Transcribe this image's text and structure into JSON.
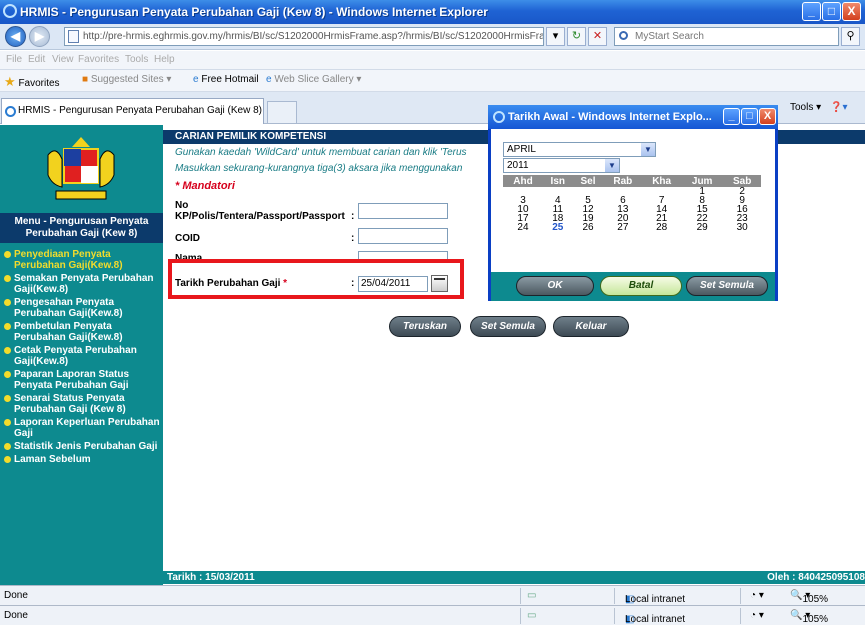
{
  "window": {
    "title": "HRMIS - Pengurusan Penyata Perubahan Gaji (Kew 8) - Windows Internet Explorer",
    "min": "_",
    "max": "□",
    "close": "X"
  },
  "address": {
    "url": "http://pre-hrmis.eghrmis.gov.my/hrmis/BI/sc/S1202000HrmisFrame.asp?/hrmis/BI/sc/S1202000HrmisFrame.as",
    "refresh": "↻",
    "stop": "✕",
    "search_placeholder": "MyStart Search"
  },
  "menubar": [
    "File",
    "Edit",
    "View",
    "Favorites",
    "Tools",
    "Help"
  ],
  "favorites": {
    "label": "Favorites",
    "items": [
      "Suggested Sites ▾",
      "Free Hotmail",
      "Web Slice Gallery ▾"
    ]
  },
  "tab": {
    "label": "HRMIS - Pengurusan Penyata Perubahan Gaji (Kew 8)",
    "tools": "Tools ▾"
  },
  "sidebar": {
    "menu_title_1": "Menu - Pengurusan Penyata",
    "menu_title_2": "Perubahan Gaji (Kew 8)",
    "items": [
      "Penyediaan Penyata Perubahan Gaji(Kew.8)",
      "Semakan Penyata Perubahan Gaji(Kew.8)",
      "Pengesahan Penyata Perubahan Gaji(Kew.8)",
      "Pembetulan Penyata Perubahan Gaji(Kew.8)",
      "Cetak Penyata Perubahan Gaji(Kew.8)",
      "Paparan Laporan Status Penyata Perubahan Gaji",
      "Senarai Status Penyata Perubahan Gaji (Kew 8)",
      "Laporan Keperluan Perubahan Gaji",
      "Statistik Jenis Perubahan Gaji",
      "Laman Sebelum"
    ]
  },
  "main": {
    "header": "CARIAN PEMILIK KOMPETENSI",
    "hint1": "Gunakan kaedah 'WildCard' untuk membuat carian dan klik 'Terus",
    "hint2": "Masukkan sekurang-kurangnya tiga(3) aksara jika menggunakan",
    "mandatory": "* Mandatori",
    "label_no1": "No",
    "label_no2": "KP/Polis/Tentera/Passport/Passport",
    "label_coid": "COID",
    "label_nama": "Nama",
    "label_tarikh": "Tarikh Perubahan Gaji",
    "tarikh_star": " *",
    "colon": ":",
    "tarikh_value": "25/04/2011",
    "buttons": [
      "Teruskan",
      "Set Semula",
      "Keluar"
    ],
    "footer_left": "Tarikh : 15/03/2011",
    "footer_right": "Oleh : 840425095108"
  },
  "popup": {
    "title": "Tarikh Awal - Windows Internet Explo...",
    "month": "APRIL",
    "year": "2011",
    "weekdays": [
      "Ahd",
      "Isn",
      "Sel",
      "Rab",
      "Kha",
      "Jum",
      "Sab"
    ],
    "weeks": [
      [
        "",
        "",
        "",
        "",
        "",
        "1",
        "2"
      ],
      [
        "3",
        "4",
        "5",
        "6",
        "7",
        "8",
        "9"
      ],
      [
        "10",
        "11",
        "12",
        "13",
        "14",
        "15",
        "16"
      ],
      [
        "17",
        "18",
        "19",
        "20",
        "21",
        "22",
        "23"
      ],
      [
        "24",
        "25",
        "26",
        "27",
        "28",
        "29",
        "30"
      ]
    ],
    "today": "25",
    "ok": "OK",
    "batal": "Batal",
    "set_semula": "Set Semula"
  },
  "status": {
    "done": "Done",
    "zone": "Local intranet",
    "zoom": "105%"
  }
}
